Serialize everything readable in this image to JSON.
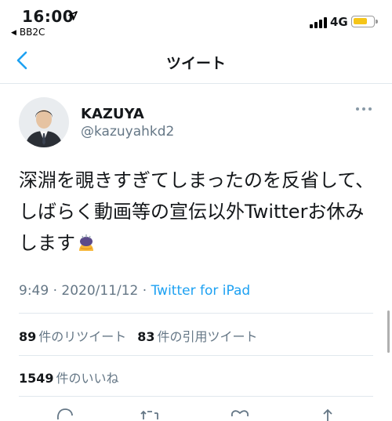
{
  "status_bar": {
    "time": "16:00",
    "back_app": "BB2C",
    "network": "4G",
    "battery_level": 0.65
  },
  "nav": {
    "title": "ツイート"
  },
  "tweet": {
    "author_name": "KAZUYA",
    "author_handle": "@kazuyahkd2",
    "text": "深淵を覗きすぎてしまったのを反省して、しばらく動画等の宣伝以外Twitterお休みします",
    "emoji": "person-bowing-emoji",
    "time": "9:49 · 2020/11/12 · ",
    "source": "Twitter for iPad"
  },
  "stats": {
    "retweets_count": "89",
    "retweets_label": "件のリツイート",
    "quotes_count": "83",
    "quotes_label": "件の引用ツイート",
    "likes_count": "1549",
    "likes_label": "件のいいね"
  },
  "actions": [
    "reply-icon",
    "retweet-icon",
    "like-icon",
    "share-icon"
  ],
  "colors": {
    "link": "#1da1f2",
    "muted": "#657786",
    "text": "#14171a",
    "battery": "#f5c518"
  }
}
